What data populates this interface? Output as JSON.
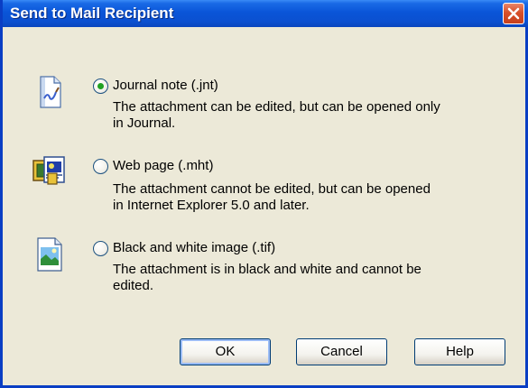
{
  "window": {
    "title": "Send to Mail Recipient"
  },
  "options": [
    {
      "label": "Journal note (.jnt)",
      "desc_line1": "The attachment can be edited, but can be opened only",
      "desc_line2": "in Journal.",
      "selected": true,
      "icon": "journal-note-icon"
    },
    {
      "label": "Web page (.mht)",
      "desc_line1": "The attachment cannot be edited, but can be opened",
      "desc_line2": "in Internet Explorer 5.0 and later.",
      "selected": false,
      "icon": "web-page-icon"
    },
    {
      "label": "Black and white image (.tif)",
      "desc_line1": "The attachment is in black and white and cannot be",
      "desc_line2": "edited.",
      "selected": false,
      "icon": "image-file-icon"
    }
  ],
  "buttons": {
    "ok": "OK",
    "cancel": "Cancel",
    "help": "Help"
  },
  "colors": {
    "titlebar": "#0a55d8",
    "face": "#ece9d8",
    "close": "#d8502a",
    "radio_dot": "#21a121"
  }
}
